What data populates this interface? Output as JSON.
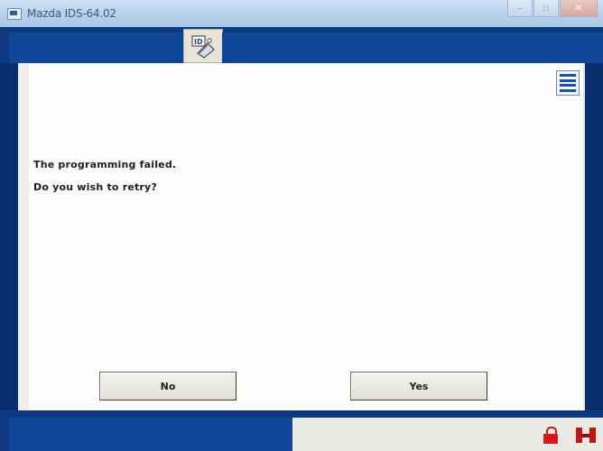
{
  "window": {
    "title": "Mazda IDS-64.02",
    "minimize_glyph": "–",
    "maximize_glyph": "□",
    "close_glyph": "✕"
  },
  "toolbar": {
    "center_icon": "ids-tool-icon"
  },
  "sidebar": {
    "menu_icon": "list-menu-icon"
  },
  "dialog": {
    "line1": "The programming failed.",
    "line2": "Do you wish to retry?",
    "no_label": "No",
    "yes_label": "Yes"
  },
  "status": {
    "lock_icon": "lock-icon",
    "vci_icon": "vci-connector-icon"
  },
  "colors": {
    "frame_blue": "#0c3a82",
    "panel_white": "#fdfdfb",
    "status_red": "#d6181c"
  }
}
